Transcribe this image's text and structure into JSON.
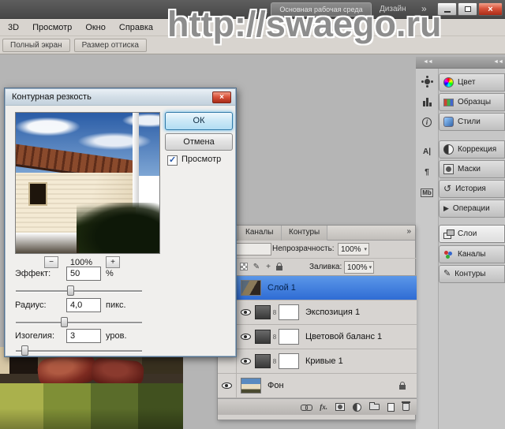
{
  "watermark": "http://swaego.ru",
  "app_bar": {
    "workspace_button": "Основная рабочая среда",
    "design_label": "Дизайн",
    "overflow_glyph": "»",
    "close_glyph": "×"
  },
  "menu_bar": {
    "items": [
      "3D",
      "Просмотр",
      "Окно",
      "Справка"
    ]
  },
  "options_bar": {
    "buttons": [
      "Полный экран",
      "Размер оттиска"
    ]
  },
  "dialog": {
    "title": "Контурная резкость",
    "close_glyph": "×",
    "ok_label": "ОК",
    "cancel_label": "Отмена",
    "preview_label": "Просмотр",
    "zoom_minus": "−",
    "zoom_value": "100%",
    "zoom_plus": "+",
    "fields": [
      {
        "label": "Эффект:",
        "value": "50",
        "unit": "%",
        "pos": 43
      },
      {
        "label": "Радиус:",
        "value": "4,0",
        "unit": "пикс.",
        "pos": 38
      },
      {
        "label": "Изогелия:",
        "value": "3",
        "unit": "уров.",
        "pos": 7
      }
    ]
  },
  "dock": {
    "collapse_glyph": "◄◄",
    "strip_icons": [
      {
        "name": "sun"
      },
      {
        "name": "histogram"
      },
      {
        "name": "info",
        "glyph": "i"
      },
      {
        "name": "character",
        "glyph": "A|"
      },
      {
        "name": "paragraph",
        "glyph": "¶"
      },
      {
        "name": "measurement",
        "glyph": "Mb"
      }
    ],
    "buttons": [
      {
        "label": "Цвет"
      },
      {
        "label": "Образцы"
      },
      {
        "label": "Стили"
      },
      {
        "label": "Коррекция"
      },
      {
        "label": "Маски"
      },
      {
        "label": "История"
      },
      {
        "label": "Операции"
      },
      {
        "label": "Слои",
        "active": true
      },
      {
        "label": "Каналы"
      },
      {
        "label": "Контуры"
      }
    ]
  },
  "layers_panel": {
    "tabs": [
      "Каналы",
      "Контуры"
    ],
    "menu_glyph": "»",
    "opacity_label": "Непрозрачность:",
    "opacity_value": "100%",
    "fill_label": "Заливка:",
    "fill_value": "100%",
    "fx_label": "fx.",
    "layers": [
      {
        "name": "Слой 1",
        "selected": true
      },
      {
        "name": "Экспозиция 1"
      },
      {
        "name": "Цветовой баланс 1"
      },
      {
        "name": "Кривые 1"
      },
      {
        "name": "Фон",
        "locked": true
      }
    ]
  },
  "colors": {
    "selection_blue": "#3b78d6",
    "close_red": "#c9402c",
    "canvas_gray": "#b5b5b5"
  }
}
